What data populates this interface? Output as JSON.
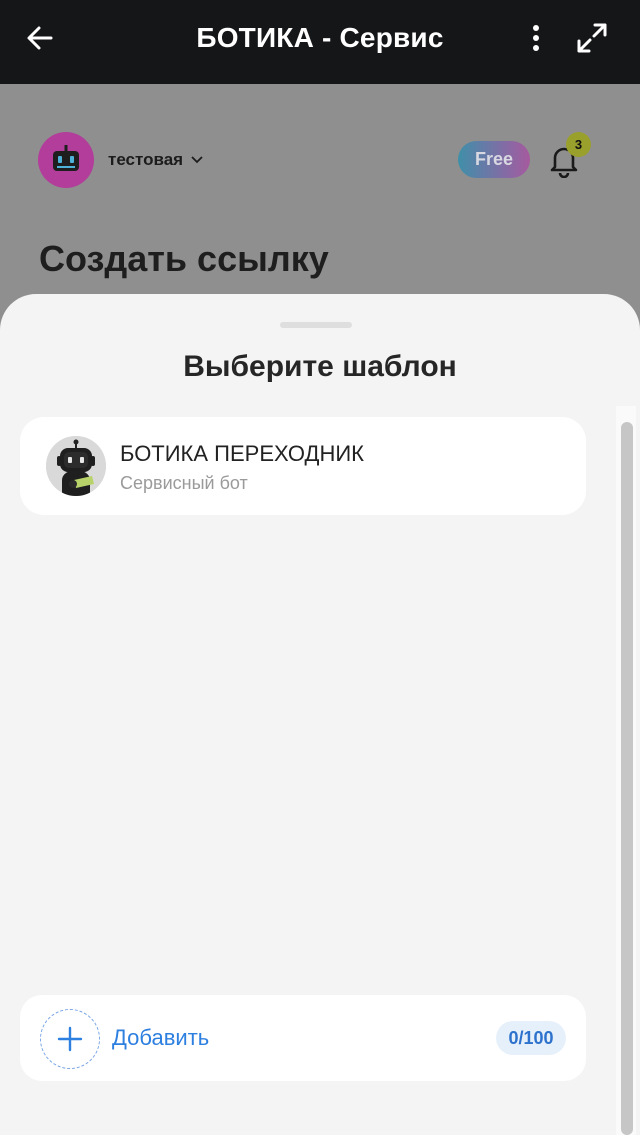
{
  "header": {
    "title": "БОТИКА - Сервис",
    "back_icon": "arrow-left-icon",
    "menu_icon": "more-vertical-icon",
    "expand_icon": "expand-icon"
  },
  "page": {
    "profile_name": "тестовая",
    "plan_badge": "Free",
    "notifications_count": "3",
    "title": "Создать ссылку"
  },
  "sheet": {
    "title": "Выберите шаблон",
    "templates": [
      {
        "name": "БОТИКА ПЕРЕХОДНИК",
        "subtitle": "Сервисный бот"
      }
    ],
    "add_label": "Добавить",
    "counter": "0/100"
  },
  "colors": {
    "accent": "#2d7fe0",
    "header_bg": "#151618",
    "avatar_bg": "#b23d9a",
    "badge_count_bg": "#9aa02c"
  }
}
